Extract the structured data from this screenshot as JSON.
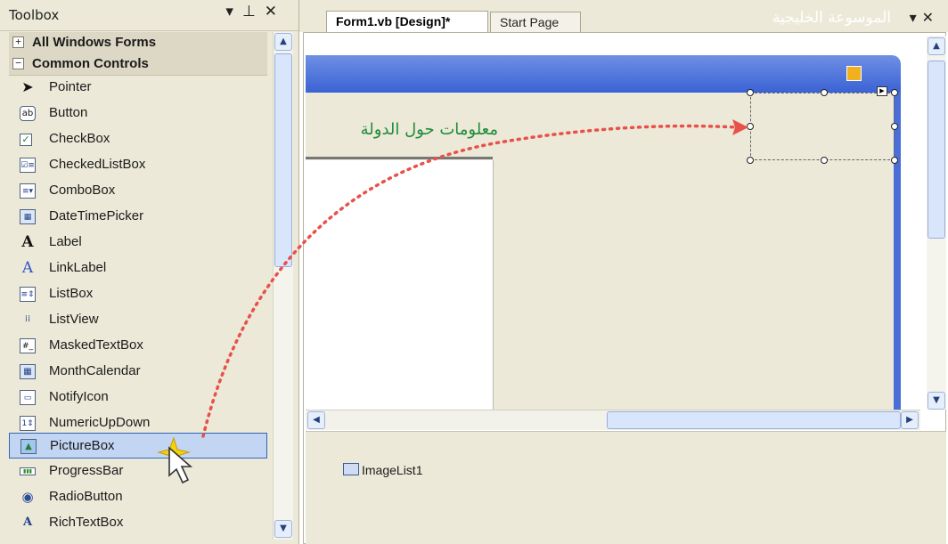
{
  "toolbox": {
    "title": "Toolbox",
    "groups": [
      {
        "label": "All Windows Forms",
        "state": "+"
      },
      {
        "label": "Common Controls",
        "state": "−"
      }
    ],
    "items": [
      {
        "label": "Pointer",
        "icon": "pointer-icon"
      },
      {
        "label": "Button",
        "icon": "button-icon"
      },
      {
        "label": "CheckBox",
        "icon": "checkbox-icon"
      },
      {
        "label": "CheckedListBox",
        "icon": "checkedlistbox-icon"
      },
      {
        "label": "ComboBox",
        "icon": "combobox-icon"
      },
      {
        "label": "DateTimePicker",
        "icon": "datetimepicker-icon"
      },
      {
        "label": "Label",
        "icon": "label-icon"
      },
      {
        "label": "LinkLabel",
        "icon": "linklabel-icon"
      },
      {
        "label": "ListBox",
        "icon": "listbox-icon"
      },
      {
        "label": "ListView",
        "icon": "listview-icon"
      },
      {
        "label": "MaskedTextBox",
        "icon": "maskedtextbox-icon"
      },
      {
        "label": "MonthCalendar",
        "icon": "monthcalendar-icon"
      },
      {
        "label": "NotifyIcon",
        "icon": "notifyicon-icon"
      },
      {
        "label": "NumericUpDown",
        "icon": "numericupdown-icon"
      },
      {
        "label": "PictureBox",
        "icon": "picturebox-icon"
      },
      {
        "label": "ProgressBar",
        "icon": "progressbar-icon"
      },
      {
        "label": "RadioButton",
        "icon": "radiobutton-icon"
      },
      {
        "label": "RichTextBox",
        "icon": "richtextbox-icon"
      }
    ]
  },
  "designer": {
    "tabs": [
      {
        "label": "Form1.vb [Design]*"
      },
      {
        "label": "Start Page"
      }
    ],
    "form_title": "الموسوعة الخليجية",
    "tab_text": "معلومات حول الدولة",
    "tray_item": "ImageList1"
  },
  "colors": {
    "form_title_bar": "#3a62d4",
    "selected_item": "#c2d5f2",
    "drag_arrow": "#e8514a",
    "tab_text": "#1f8b3a"
  }
}
